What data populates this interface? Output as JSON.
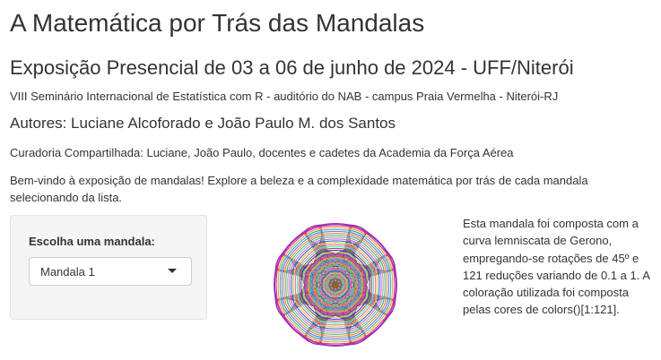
{
  "header": {
    "title": "A Matemática por Trás das Mandalas",
    "subtitle": "Exposição Presencial de 03 a 06 de junho de 2024 - UFF/Niterói",
    "event": "VIII Seminário Internacional de Estatística com R - auditório do NAB - campus Praia Vermelha - Niterói-RJ",
    "authors": "Autores: Luciane Alcoforado e João Paulo M. dos Santos",
    "curadoria": "Curadoria Compartilhada: Luciane, João Paulo, docentes e cadetes da Academia da Força Aérea"
  },
  "intro": {
    "welcome": "Bem-vindo à exposição de mandalas! Explore a beleza e a complexidade matemática por trás de cada mandala selecionando da lista."
  },
  "sidebar": {
    "select_label": "Escolha uma mandala:",
    "selected_value": "Mandala 1",
    "caret_icon": "caret-down-icon"
  },
  "main": {
    "description": "Esta mandala foi composta com a curva lemniscata de Gerono, empregando-se rotações de 45º e 121 reduções variando de 0.1 a 1. A coloração utilizada foi composta pelas cores de colors()[1:121]."
  },
  "mandala": {
    "curve": "lemniscata de Gerono",
    "rotation_degrees": 45,
    "reductions": 121,
    "scale_min": 0.1,
    "scale_max": 1,
    "palette": [
      "#9c2fb0",
      "#d23f8a",
      "#e9a33b",
      "#3aa7c9",
      "#7b7bd6",
      "#f08a3c",
      "#4cba8d",
      "#a6a6a6",
      "#c86fd0",
      "#2f6fbf",
      "#d9c24a",
      "#e56c8b",
      "#5fd0c8",
      "#8f5a3b",
      "#3e3ea8",
      "#b0d96a"
    ],
    "outer_ring_color": "#a32fc0"
  }
}
